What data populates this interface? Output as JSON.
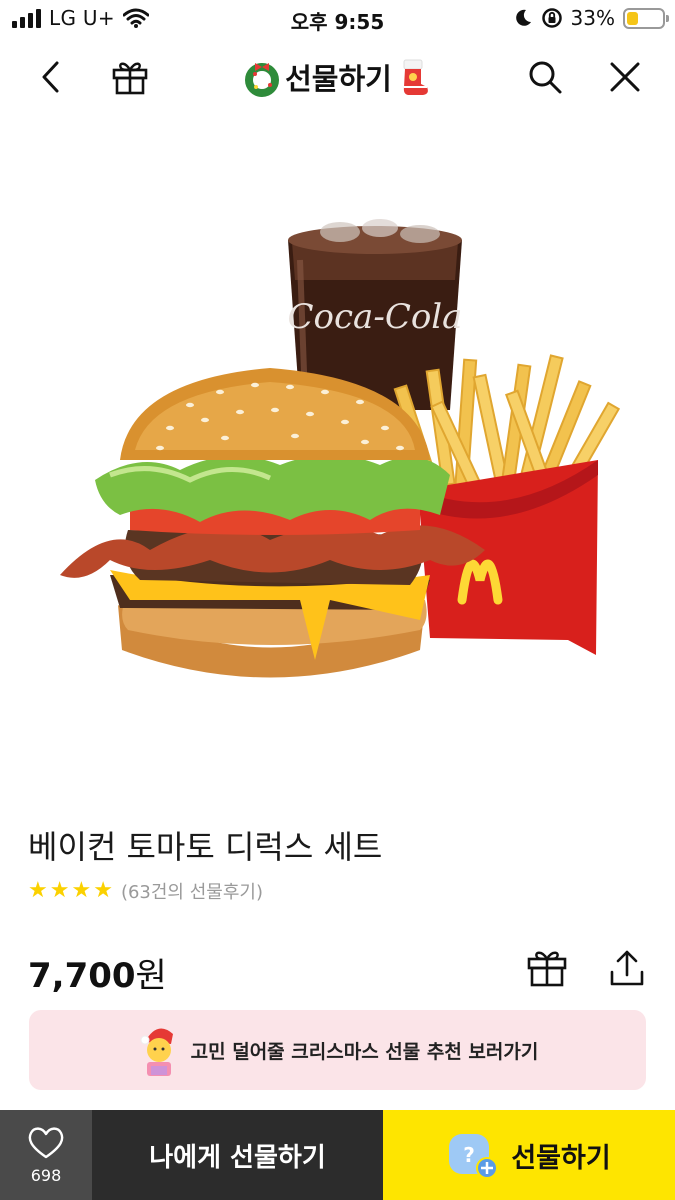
{
  "status_bar": {
    "carrier": "LG U+",
    "time": "오후 9:55",
    "battery_percent": "33%",
    "battery_level": 0.33
  },
  "nav": {
    "title": "선물하기",
    "back_icon": "chevron-left-icon",
    "gift_icon": "gift-box-icon",
    "search_icon": "search-icon",
    "close_icon": "close-icon"
  },
  "product": {
    "name": "베이컨 토마토 디럭스 세트",
    "rating_stars": 4,
    "review_count_text": "(63건의 선물후기)",
    "price_number": "7,700",
    "price_unit": "원",
    "cola_brand": "Coca-Cola"
  },
  "banner": {
    "text": "고민 덜어줄 크리스마스 선물 추천 보러가기"
  },
  "bottom_bar": {
    "like_count": "698",
    "self_gift_label": "나에게 선물하기",
    "gift_label": "선물하기"
  },
  "colors": {
    "brand_yellow": "#fee500",
    "dark_button": "#2c2c2c",
    "like_button": "#4a4a4a",
    "banner_pink": "#fbe4e8",
    "star_yellow": "#fbd100"
  }
}
